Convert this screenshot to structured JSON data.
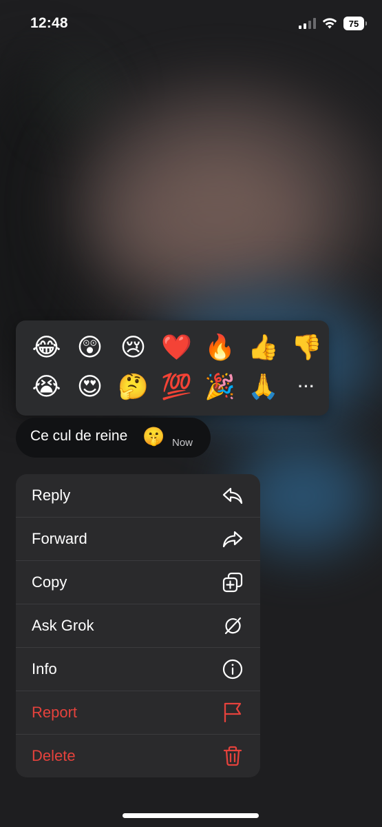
{
  "status_bar": {
    "time": "12:48",
    "battery_level": "75",
    "icons": [
      "cellular-signal-icon",
      "wifi-icon",
      "battery-icon"
    ]
  },
  "reactions": {
    "emojis": [
      {
        "name": "face-with-tears-of-joy",
        "char": "😂"
      },
      {
        "name": "astonished-face",
        "char": "😲"
      },
      {
        "name": "crying-face",
        "char": "😢"
      },
      {
        "name": "red-heart",
        "char": "❤️"
      },
      {
        "name": "fire",
        "char": "🔥"
      },
      {
        "name": "thumbs-up",
        "char": "👍"
      },
      {
        "name": "thumbs-down",
        "char": "👎"
      },
      {
        "name": "loudly-crying-face",
        "char": "😭"
      },
      {
        "name": "heart-eyes",
        "char": "😍"
      },
      {
        "name": "thinking-face",
        "char": "🤔"
      },
      {
        "name": "hundred-points",
        "char": "💯"
      },
      {
        "name": "party-popper",
        "char": "🎉"
      },
      {
        "name": "folded-hands",
        "char": "🙏"
      }
    ],
    "more_label": "···"
  },
  "message": {
    "text": "Ce cul de reine",
    "emoji": "🤫",
    "time": "Now"
  },
  "menu": {
    "items": [
      {
        "label": "Reply",
        "icon": "reply-icon",
        "danger": false
      },
      {
        "label": "Forward",
        "icon": "forward-icon",
        "danger": false
      },
      {
        "label": "Copy",
        "icon": "copy-icon",
        "danger": false
      },
      {
        "label": "Ask Grok",
        "icon": "grok-icon",
        "danger": false
      },
      {
        "label": "Info",
        "icon": "info-icon",
        "danger": false
      },
      {
        "label": "Report",
        "icon": "flag-icon",
        "danger": true
      },
      {
        "label": "Delete",
        "icon": "trash-icon",
        "danger": true
      }
    ]
  },
  "colors": {
    "danger": "#e5423c",
    "menu_bg": "#2a2a2c",
    "panel_bg": "#2b2c2e",
    "bubble_bg": "#111214"
  }
}
